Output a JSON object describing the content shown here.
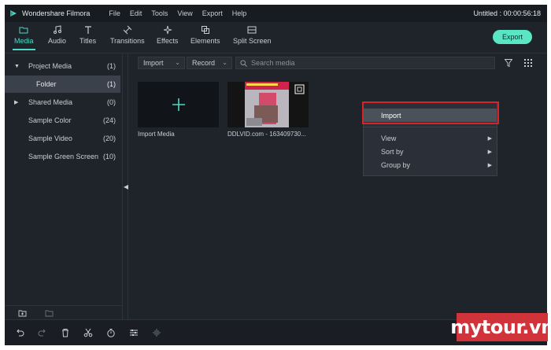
{
  "app": {
    "name": "Wondershare Filmora",
    "project_title": "Untitled : 00:00:56:18"
  },
  "menu": [
    "File",
    "Edit",
    "Tools",
    "View",
    "Export",
    "Help"
  ],
  "toolbar": {
    "tabs": [
      {
        "label": "Media",
        "icon": "folder-icon",
        "active": true
      },
      {
        "label": "Audio",
        "icon": "music-note-icon"
      },
      {
        "label": "Titles",
        "icon": "text-t-icon"
      },
      {
        "label": "Transitions",
        "icon": "transitions-icon"
      },
      {
        "label": "Effects",
        "icon": "effects-sparkle-icon"
      },
      {
        "label": "Elements",
        "icon": "elements-icon"
      },
      {
        "label": "Split Screen",
        "icon": "split-screen-icon"
      }
    ],
    "export_label": "Export"
  },
  "tree": [
    {
      "label": "Project Media",
      "count": "(1)",
      "expander": "▼"
    },
    {
      "label": "Folder",
      "count": "(1)",
      "selected": true
    },
    {
      "label": "Shared Media",
      "count": "(0)",
      "expander": "▶"
    },
    {
      "label": "Sample Color",
      "count": "(24)"
    },
    {
      "label": "Sample Video",
      "count": "(20)"
    },
    {
      "label": "Sample Green Screen",
      "count": "(10)"
    }
  ],
  "media": {
    "import_dropdown": "Import",
    "record_dropdown": "Record",
    "search_placeholder": "Search media",
    "tiles": [
      {
        "label": "Import Media"
      },
      {
        "label": "DDLVID.com - 163409730..."
      }
    ]
  },
  "context_menu": {
    "items": [
      {
        "label": "Import",
        "highlighted": true
      },
      {
        "label": "View",
        "submenu": "▶"
      },
      {
        "label": "Sort by",
        "submenu": "▶"
      },
      {
        "label": "Group by",
        "submenu": "▶"
      }
    ]
  },
  "watermark": "mytour.vn",
  "colors": {
    "accent": "#4fd8c4",
    "export_button": "#5ae6c5",
    "highlight_box": "#d8232a",
    "watermark_bg": "#d0343a"
  }
}
